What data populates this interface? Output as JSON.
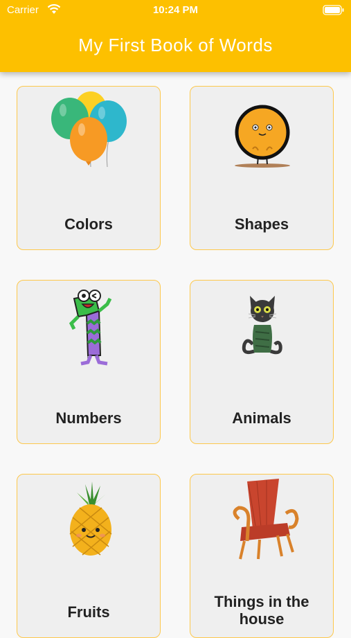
{
  "status_bar": {
    "carrier": "Carrier",
    "time": "10:24 PM"
  },
  "header": {
    "title": "My First Book of Words"
  },
  "categories": [
    {
      "label": "Colors",
      "icon": "balloons-icon"
    },
    {
      "label": "Shapes",
      "icon": "circle-character-icon"
    },
    {
      "label": "Numbers",
      "icon": "number-one-character-icon"
    },
    {
      "label": "Animals",
      "icon": "cat-icon"
    },
    {
      "label": "Fruits",
      "icon": "pineapple-icon"
    },
    {
      "label": "Things in the house",
      "icon": "chair-icon"
    }
  ],
  "colors": {
    "header": "#fdc000",
    "card_border": "#fdc84b",
    "card_bg": "#efefef"
  }
}
